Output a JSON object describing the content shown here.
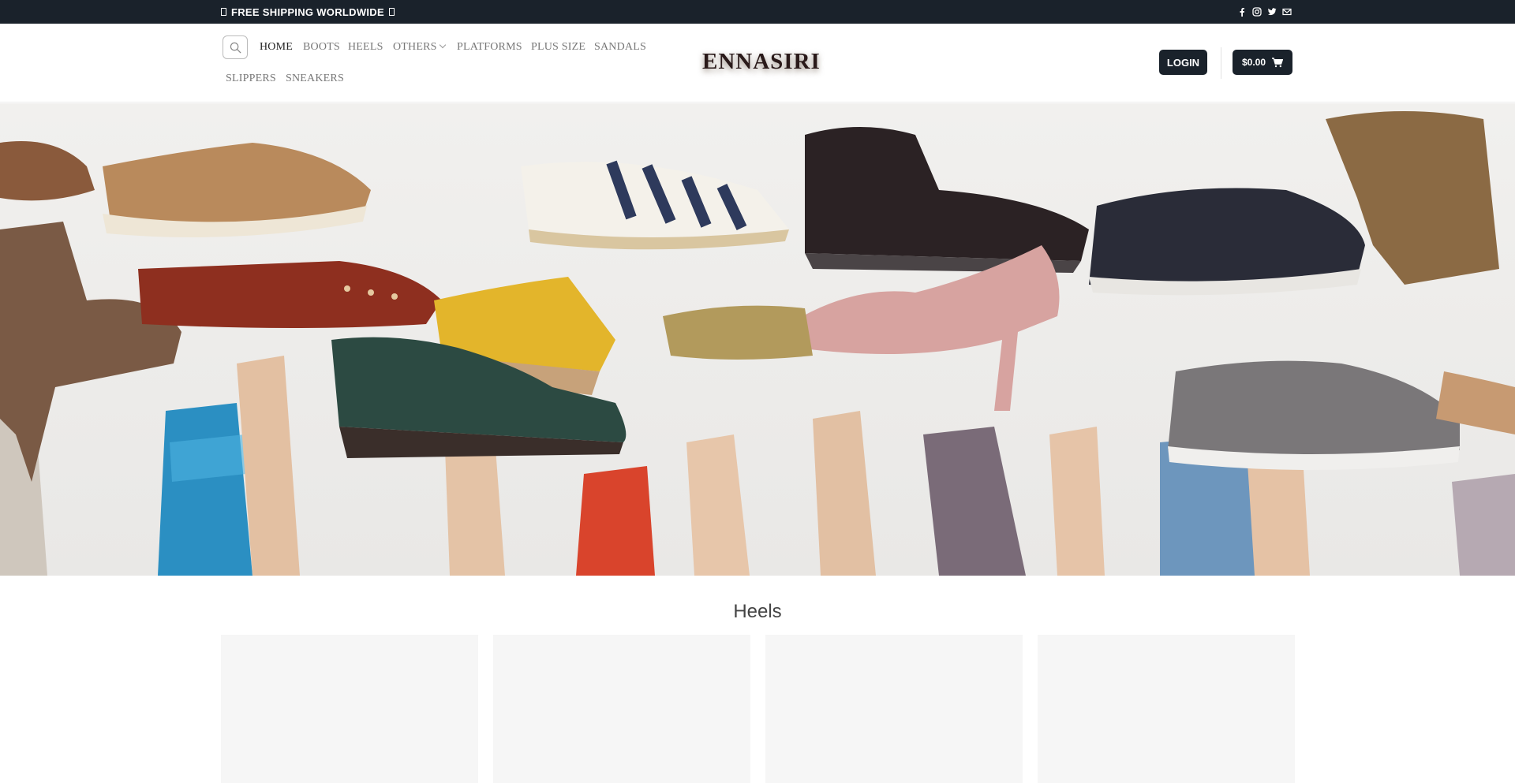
{
  "topbar": {
    "shipping_text": "FREE SHIPPING WORLDWIDE",
    "social_icons": [
      "facebook-icon",
      "instagram-icon",
      "twitter-icon",
      "email-icon"
    ]
  },
  "header": {
    "logo": "ENNASIRI",
    "nav": [
      {
        "label": "HOME",
        "active": true
      },
      {
        "label": "BOOTS"
      },
      {
        "label": "HEELS"
      },
      {
        "label": "OTHERS",
        "has_dropdown": true
      },
      {
        "label": "PLATFORMS"
      },
      {
        "label": "PLUS SIZE"
      },
      {
        "label": "SANDALS"
      },
      {
        "label": "SLIPPERS"
      },
      {
        "label": "SNEAKERS"
      }
    ],
    "login_label": "LOGIN",
    "cart_total": "$0.00"
  },
  "hero": {
    "image": "hands-holding-shoes-photo"
  },
  "section": {
    "title": "Heels"
  },
  "colors": {
    "dark": "#1a222b",
    "card_bg": "#f6f6f6"
  }
}
